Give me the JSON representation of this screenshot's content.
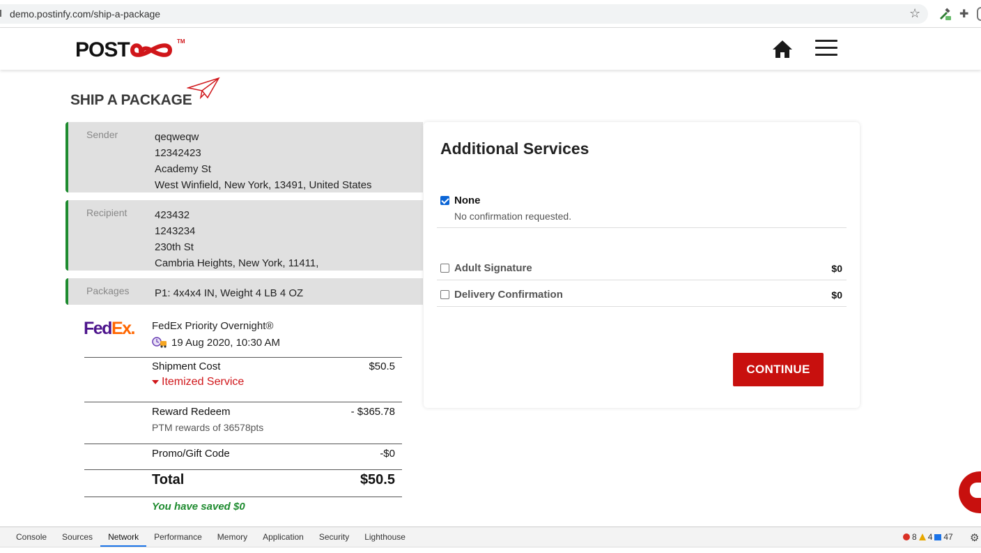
{
  "browser": {
    "url": "demo.postinfy.com/ship-a-package"
  },
  "header": {
    "logo_text": "POST",
    "logo_tm": "TM"
  },
  "page": {
    "title": "SHIP A PACKAGE"
  },
  "sender": {
    "label": "Sender",
    "lines": [
      "qeqweqw",
      "12342423",
      "Academy St",
      "West Winfield, New York, 13491, United States"
    ]
  },
  "recipient": {
    "label": "Recipient",
    "lines": [
      "423432",
      "1243234",
      "230th St",
      "Cambria Heights, New York, 11411,"
    ]
  },
  "packages": {
    "label": "Packages",
    "value": "P1: 4x4x4 IN, Weight 4 LB 4 OZ"
  },
  "quote": {
    "carrier_fed": "Fed",
    "carrier_ex": "Ex.",
    "service": "FedEx Priority Overnight®",
    "delivery_date": "19 Aug 2020, 10:30 AM",
    "shipment_cost_label": "Shipment Cost",
    "shipment_cost_value": "$50.5",
    "itemized_label": "Itemized Service",
    "reward_label": "Reward Redeem",
    "reward_value": "- $365.78",
    "reward_sub": "PTM rewards of 36578pts",
    "promo_label": "Promo/Gift Code",
    "promo_value": "-$0",
    "total_label": "Total",
    "total_value": "$50.5",
    "saved": "You have saved $0"
  },
  "services": {
    "title": "Additional Services",
    "options": [
      {
        "name": "None",
        "description": "No confirmation requested.",
        "price": "",
        "checked": true
      },
      {
        "name": "Adult Signature",
        "description": "",
        "price": "$0",
        "checked": false
      },
      {
        "name": "Delivery Confirmation",
        "description": "",
        "price": "$0",
        "checked": false
      }
    ],
    "continue_label": "CONTINUE"
  },
  "colors": {
    "brand_red": "#c8100e",
    "accent_green": "#1e8b2f",
    "fedex_purple": "#4d148c",
    "fedex_orange": "#ff6600"
  },
  "devtools": {
    "tabs": [
      "Console",
      "Sources",
      "Network",
      "Performance",
      "Memory",
      "Application",
      "Security",
      "Lighthouse"
    ],
    "active_tab": "Network",
    "errors": "8",
    "warnings": "4",
    "messages": "47"
  }
}
